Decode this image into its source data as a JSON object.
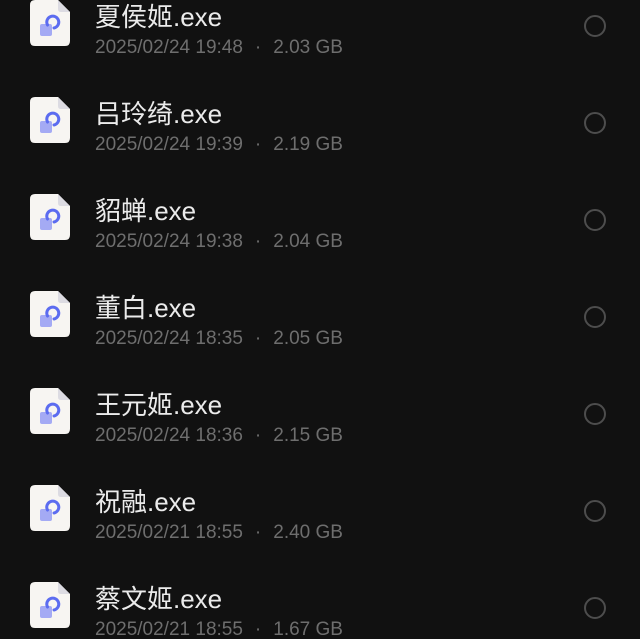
{
  "files": [
    {
      "name": "夏侯姬.exe",
      "date": "2025/02/24 19:48",
      "size": "2.03 GB",
      "selected": false
    },
    {
      "name": "吕玲绮.exe",
      "date": "2025/02/24 19:39",
      "size": "2.19 GB",
      "selected": false
    },
    {
      "name": "貂蝉.exe",
      "date": "2025/02/24 19:38",
      "size": "2.04 GB",
      "selected": false
    },
    {
      "name": "董白.exe",
      "date": "2025/02/24 18:35",
      "size": "2.05 GB",
      "selected": false
    },
    {
      "name": "王元姬.exe",
      "date": "2025/02/24 18:36",
      "size": "2.15 GB",
      "selected": false
    },
    {
      "name": "祝融.exe",
      "date": "2025/02/21 18:55",
      "size": "2.40 GB",
      "selected": false
    },
    {
      "name": "蔡文姬.exe",
      "date": "2025/02/21 18:55",
      "size": "1.67 GB",
      "selected": false
    }
  ],
  "separator": "·",
  "file_icon": "exe-file-icon",
  "select_control": "radio-circle",
  "colors": {
    "background": "#111111",
    "name_text": "#ebebeb",
    "meta_text": "#6e6e6e",
    "radio_border": "#4d4d4d",
    "icon_page": "#f7f5f2",
    "icon_fold": "#dcdbe2",
    "icon_accent": "#5c6cf0",
    "icon_accent_light": "#a4aaf4"
  }
}
